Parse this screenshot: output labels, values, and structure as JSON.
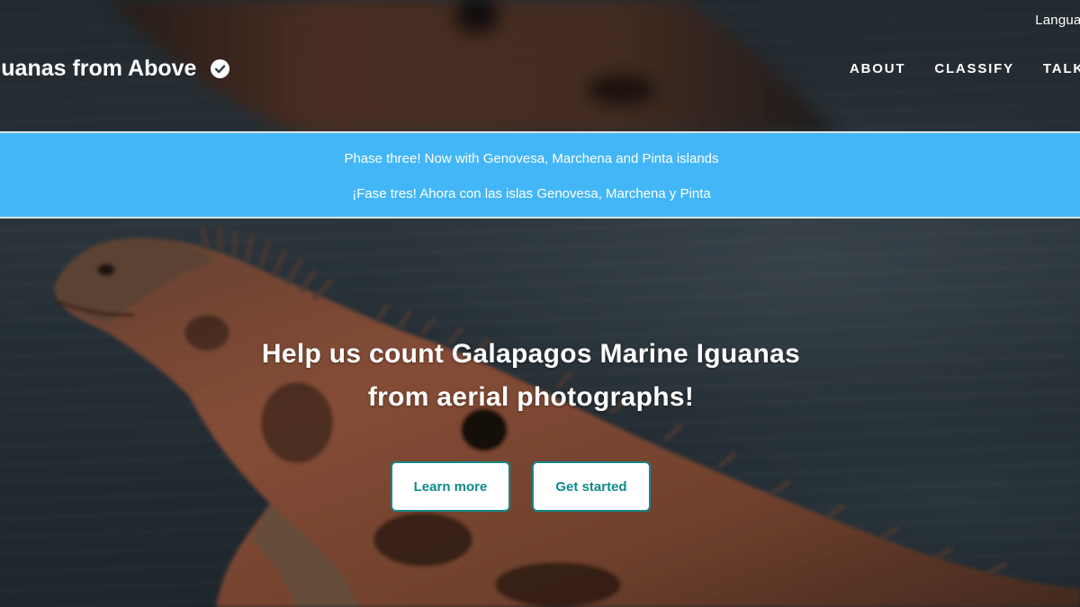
{
  "top_bar": {
    "language_label": "Languag"
  },
  "header": {
    "project_title": "guanas from Above",
    "verified_icon": "check-circle-icon",
    "nav": [
      {
        "label": "ABOUT"
      },
      {
        "label": "CLASSIFY"
      },
      {
        "label": "TALK"
      }
    ]
  },
  "banner": {
    "line_en": "Phase three! Now with Genovesa, Marchena and Pinta islands",
    "line_es": "¡Fase tres! Ahora con las islas Genovesa, Marchena y Pinta",
    "background_color": "#43b6f7"
  },
  "hero": {
    "title": "Help us count Galapagos Marine Iguanas from aerial photographs!",
    "buttons": {
      "learn_more": "Learn more",
      "get_started": "Get started"
    },
    "button_accent_color": "#15888c"
  }
}
